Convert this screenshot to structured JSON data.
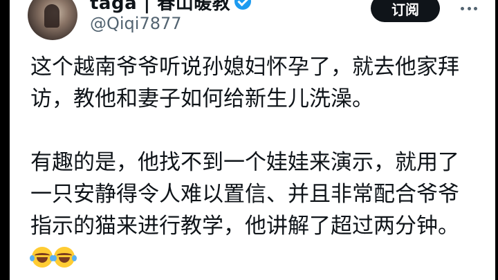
{
  "author": {
    "display_name": "taga | 春山暖教",
    "handle": "@Qiqi7877"
  },
  "actions": {
    "subscribe_label": "订阅"
  },
  "post": {
    "paragraph_1": "这个越南爷爷听说孙媳妇怀孕了，就去他家拜访，教他和妻子如何给新生儿洗澡。",
    "paragraph_2": "有趣的是，他找不到一个娃娃来演示，就用了一只安静得令人难以置信、并且非常配合爷爷指示的猫来进行教学，他讲解了超过两分钟。",
    "emojis": [
      "face-with-tears-of-joy",
      "face-with-tears-of-joy"
    ]
  },
  "colors": {
    "verified": "#1d9bf0",
    "button_bg": "#0f1419",
    "text": "#0f1419",
    "secondary_text": "#536471"
  }
}
